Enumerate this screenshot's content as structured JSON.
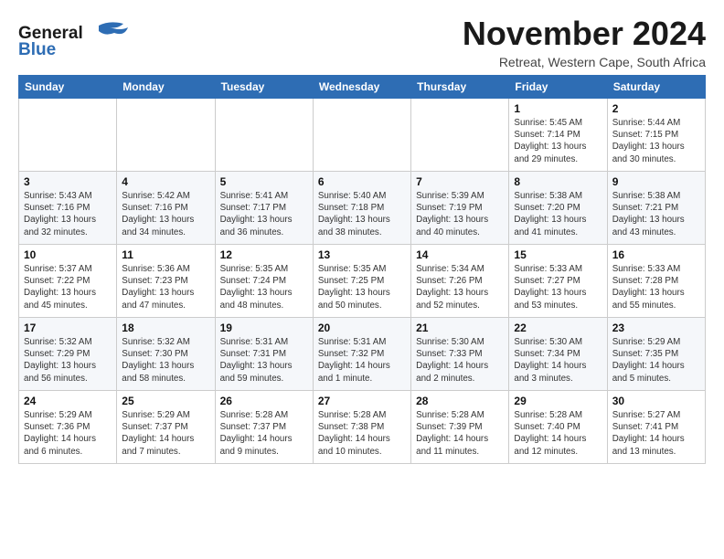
{
  "header": {
    "logo_general": "General",
    "logo_blue": "Blue",
    "month": "November 2024",
    "subtitle": "Retreat, Western Cape, South Africa"
  },
  "days_of_week": [
    "Sunday",
    "Monday",
    "Tuesday",
    "Wednesday",
    "Thursday",
    "Friday",
    "Saturday"
  ],
  "weeks": [
    [
      {
        "day": "",
        "info": ""
      },
      {
        "day": "",
        "info": ""
      },
      {
        "day": "",
        "info": ""
      },
      {
        "day": "",
        "info": ""
      },
      {
        "day": "",
        "info": ""
      },
      {
        "day": "1",
        "info": "Sunrise: 5:45 AM\nSunset: 7:14 PM\nDaylight: 13 hours\nand 29 minutes."
      },
      {
        "day": "2",
        "info": "Sunrise: 5:44 AM\nSunset: 7:15 PM\nDaylight: 13 hours\nand 30 minutes."
      }
    ],
    [
      {
        "day": "3",
        "info": "Sunrise: 5:43 AM\nSunset: 7:16 PM\nDaylight: 13 hours\nand 32 minutes."
      },
      {
        "day": "4",
        "info": "Sunrise: 5:42 AM\nSunset: 7:16 PM\nDaylight: 13 hours\nand 34 minutes."
      },
      {
        "day": "5",
        "info": "Sunrise: 5:41 AM\nSunset: 7:17 PM\nDaylight: 13 hours\nand 36 minutes."
      },
      {
        "day": "6",
        "info": "Sunrise: 5:40 AM\nSunset: 7:18 PM\nDaylight: 13 hours\nand 38 minutes."
      },
      {
        "day": "7",
        "info": "Sunrise: 5:39 AM\nSunset: 7:19 PM\nDaylight: 13 hours\nand 40 minutes."
      },
      {
        "day": "8",
        "info": "Sunrise: 5:38 AM\nSunset: 7:20 PM\nDaylight: 13 hours\nand 41 minutes."
      },
      {
        "day": "9",
        "info": "Sunrise: 5:38 AM\nSunset: 7:21 PM\nDaylight: 13 hours\nand 43 minutes."
      }
    ],
    [
      {
        "day": "10",
        "info": "Sunrise: 5:37 AM\nSunset: 7:22 PM\nDaylight: 13 hours\nand 45 minutes."
      },
      {
        "day": "11",
        "info": "Sunrise: 5:36 AM\nSunset: 7:23 PM\nDaylight: 13 hours\nand 47 minutes."
      },
      {
        "day": "12",
        "info": "Sunrise: 5:35 AM\nSunset: 7:24 PM\nDaylight: 13 hours\nand 48 minutes."
      },
      {
        "day": "13",
        "info": "Sunrise: 5:35 AM\nSunset: 7:25 PM\nDaylight: 13 hours\nand 50 minutes."
      },
      {
        "day": "14",
        "info": "Sunrise: 5:34 AM\nSunset: 7:26 PM\nDaylight: 13 hours\nand 52 minutes."
      },
      {
        "day": "15",
        "info": "Sunrise: 5:33 AM\nSunset: 7:27 PM\nDaylight: 13 hours\nand 53 minutes."
      },
      {
        "day": "16",
        "info": "Sunrise: 5:33 AM\nSunset: 7:28 PM\nDaylight: 13 hours\nand 55 minutes."
      }
    ],
    [
      {
        "day": "17",
        "info": "Sunrise: 5:32 AM\nSunset: 7:29 PM\nDaylight: 13 hours\nand 56 minutes."
      },
      {
        "day": "18",
        "info": "Sunrise: 5:32 AM\nSunset: 7:30 PM\nDaylight: 13 hours\nand 58 minutes."
      },
      {
        "day": "19",
        "info": "Sunrise: 5:31 AM\nSunset: 7:31 PM\nDaylight: 13 hours\nand 59 minutes."
      },
      {
        "day": "20",
        "info": "Sunrise: 5:31 AM\nSunset: 7:32 PM\nDaylight: 14 hours\nand 1 minute."
      },
      {
        "day": "21",
        "info": "Sunrise: 5:30 AM\nSunset: 7:33 PM\nDaylight: 14 hours\nand 2 minutes."
      },
      {
        "day": "22",
        "info": "Sunrise: 5:30 AM\nSunset: 7:34 PM\nDaylight: 14 hours\nand 3 minutes."
      },
      {
        "day": "23",
        "info": "Sunrise: 5:29 AM\nSunset: 7:35 PM\nDaylight: 14 hours\nand 5 minutes."
      }
    ],
    [
      {
        "day": "24",
        "info": "Sunrise: 5:29 AM\nSunset: 7:36 PM\nDaylight: 14 hours\nand 6 minutes."
      },
      {
        "day": "25",
        "info": "Sunrise: 5:29 AM\nSunset: 7:37 PM\nDaylight: 14 hours\nand 7 minutes."
      },
      {
        "day": "26",
        "info": "Sunrise: 5:28 AM\nSunset: 7:37 PM\nDaylight: 14 hours\nand 9 minutes."
      },
      {
        "day": "27",
        "info": "Sunrise: 5:28 AM\nSunset: 7:38 PM\nDaylight: 14 hours\nand 10 minutes."
      },
      {
        "day": "28",
        "info": "Sunrise: 5:28 AM\nSunset: 7:39 PM\nDaylight: 14 hours\nand 11 minutes."
      },
      {
        "day": "29",
        "info": "Sunrise: 5:28 AM\nSunset: 7:40 PM\nDaylight: 14 hours\nand 12 minutes."
      },
      {
        "day": "30",
        "info": "Sunrise: 5:27 AM\nSunset: 7:41 PM\nDaylight: 14 hours\nand 13 minutes."
      }
    ]
  ]
}
